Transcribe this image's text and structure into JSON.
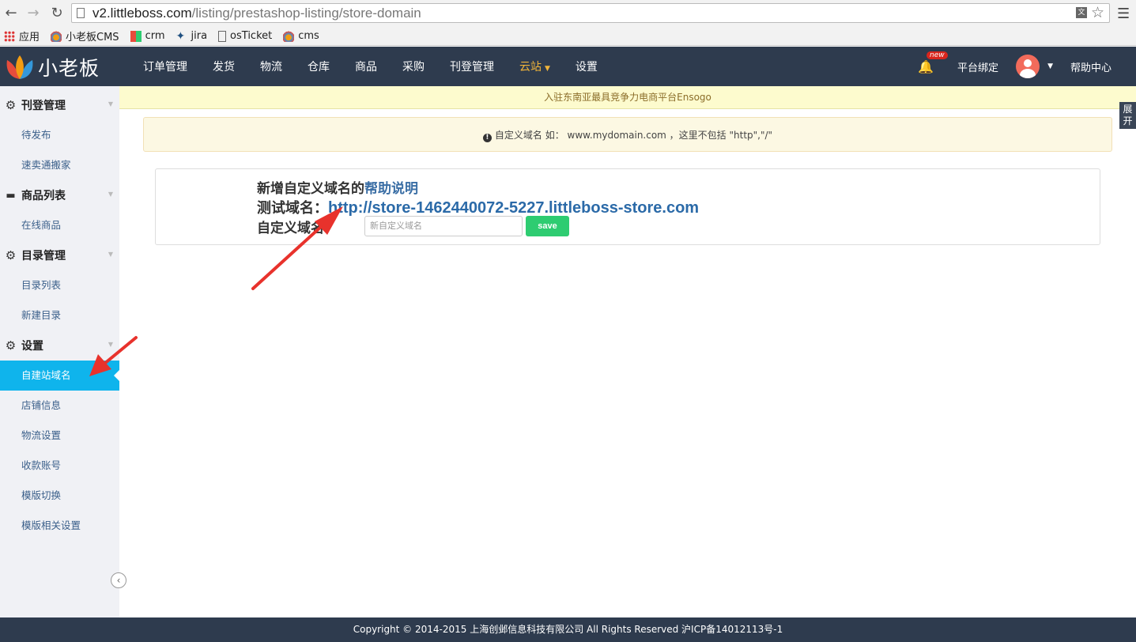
{
  "browser": {
    "url_host": "v2.littleboss.com",
    "url_path": "/listing/prestashop-listing/store-domain",
    "bookmarks": [
      {
        "label": "应用",
        "icon": "apps-icon"
      },
      {
        "label": "小老板CMS",
        "icon": "lotus-icon"
      },
      {
        "label": "crm",
        "icon": "grid-icon"
      },
      {
        "label": "jira",
        "icon": "jira-icon"
      },
      {
        "label": "osTicket",
        "icon": "page-icon"
      },
      {
        "label": "cms",
        "icon": "lotus-icon"
      }
    ]
  },
  "navbar": {
    "logo_text": "小老板",
    "items": [
      {
        "label": "订单管理"
      },
      {
        "label": "发货"
      },
      {
        "label": "物流"
      },
      {
        "label": "仓库"
      },
      {
        "label": "商品"
      },
      {
        "label": "采购"
      },
      {
        "label": "刊登管理"
      },
      {
        "label": "云站",
        "active": true
      },
      {
        "label": "设置"
      }
    ],
    "new_badge": "new",
    "bind_platform": "平台绑定",
    "help_center": "帮助中心",
    "active_color": "#f0b43a"
  },
  "sidebar": {
    "groups": [
      {
        "label": "刊登管理",
        "icon": "gear-icon",
        "items": [
          "待发布",
          "速卖通搬家"
        ]
      },
      {
        "label": "商品列表",
        "icon": "folder-icon",
        "items": [
          "在线商品"
        ]
      },
      {
        "label": "目录管理",
        "icon": "gear-icon",
        "items": [
          "目录列表",
          "新建目录"
        ]
      },
      {
        "label": "设置",
        "icon": "gear-icon",
        "items": [
          "自建站域名",
          "店铺信息",
          "物流设置",
          "收款账号",
          "模版切换",
          "模版相关设置"
        ]
      }
    ],
    "active_item": "自建站域名",
    "active_color": "#0fb4ec"
  },
  "announcement": "入驻东南亚最具竞争力电商平台Ensogo",
  "expand_tab": "展开",
  "alert": {
    "text": "自定义域名 如： www.mydomain.com ，这里不包括 \"http\",\"/\""
  },
  "form": {
    "title_prefix": "新增自定义域名的",
    "help_link": "帮助说明",
    "test_domain_label": "测试域名：",
    "test_domain": "http://store-1462440072-5227.littleboss-store.com",
    "custom_domain_label": "自定义域名：",
    "custom_domain_placeholder": "新自定义域名",
    "custom_domain_value": "",
    "save_label": "save"
  },
  "footer": "Copyright © 2014-2015 上海创邺信息科技有限公司 All Rights Reserved 沪ICP备14012113号-1",
  "colors": {
    "navbar_bg": "#2e3b4e",
    "save_button": "#2ecc71",
    "annotation_arrow": "#e8322c"
  }
}
